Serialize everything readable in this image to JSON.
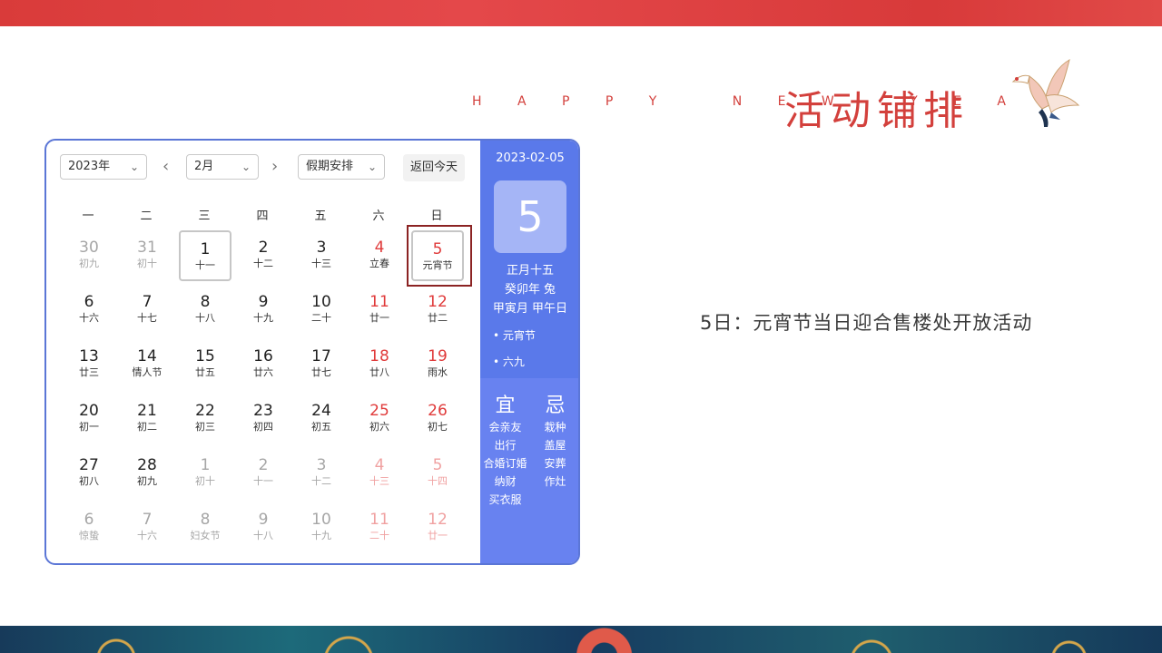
{
  "header": {
    "subtitle": "H A P P Y   N E W   Y E A R",
    "title": "活动铺排"
  },
  "calendar": {
    "year_select": "2023年",
    "month_select": "2月",
    "holiday_select": "假期安排",
    "today_button": "返回今天",
    "weekdays": [
      "一",
      "二",
      "三",
      "四",
      "五",
      "六",
      "日"
    ],
    "days": [
      {
        "num": "30",
        "lunar": "初九",
        "type": "other"
      },
      {
        "num": "31",
        "lunar": "初十",
        "type": "other"
      },
      {
        "num": "1",
        "lunar": "十一",
        "type": "today"
      },
      {
        "num": "2",
        "lunar": "十二",
        "type": "normal"
      },
      {
        "num": "3",
        "lunar": "十三",
        "type": "normal"
      },
      {
        "num": "4",
        "lunar": "立春",
        "type": "red"
      },
      {
        "num": "5",
        "lunar": "元宵节",
        "type": "red selected"
      },
      {
        "num": "6",
        "lunar": "十六",
        "type": "normal"
      },
      {
        "num": "7",
        "lunar": "十七",
        "type": "normal"
      },
      {
        "num": "8",
        "lunar": "十八",
        "type": "normal"
      },
      {
        "num": "9",
        "lunar": "十九",
        "type": "normal"
      },
      {
        "num": "10",
        "lunar": "二十",
        "type": "normal"
      },
      {
        "num": "11",
        "lunar": "廿一",
        "type": "red"
      },
      {
        "num": "12",
        "lunar": "廿二",
        "type": "red"
      },
      {
        "num": "13",
        "lunar": "廿三",
        "type": "normal"
      },
      {
        "num": "14",
        "lunar": "情人节",
        "type": "normal"
      },
      {
        "num": "15",
        "lunar": "廿五",
        "type": "normal"
      },
      {
        "num": "16",
        "lunar": "廿六",
        "type": "normal"
      },
      {
        "num": "17",
        "lunar": "廿七",
        "type": "normal"
      },
      {
        "num": "18",
        "lunar": "廿八",
        "type": "red"
      },
      {
        "num": "19",
        "lunar": "雨水",
        "type": "red"
      },
      {
        "num": "20",
        "lunar": "初一",
        "type": "normal"
      },
      {
        "num": "21",
        "lunar": "初二",
        "type": "normal"
      },
      {
        "num": "22",
        "lunar": "初三",
        "type": "normal"
      },
      {
        "num": "23",
        "lunar": "初四",
        "type": "normal"
      },
      {
        "num": "24",
        "lunar": "初五",
        "type": "normal"
      },
      {
        "num": "25",
        "lunar": "初六",
        "type": "red"
      },
      {
        "num": "26",
        "lunar": "初七",
        "type": "red"
      },
      {
        "num": "27",
        "lunar": "初八",
        "type": "normal"
      },
      {
        "num": "28",
        "lunar": "初九",
        "type": "normal"
      },
      {
        "num": "1",
        "lunar": "初十",
        "type": "other"
      },
      {
        "num": "2",
        "lunar": "十一",
        "type": "other"
      },
      {
        "num": "3",
        "lunar": "十二",
        "type": "other"
      },
      {
        "num": "4",
        "lunar": "十三",
        "type": "other red"
      },
      {
        "num": "5",
        "lunar": "十四",
        "type": "other red"
      },
      {
        "num": "6",
        "lunar": "惊蛰",
        "type": "other"
      },
      {
        "num": "7",
        "lunar": "十六",
        "type": "other"
      },
      {
        "num": "8",
        "lunar": "妇女节",
        "type": "other"
      },
      {
        "num": "9",
        "lunar": "十八",
        "type": "other"
      },
      {
        "num": "10",
        "lunar": "十九",
        "type": "other"
      },
      {
        "num": "11",
        "lunar": "二十",
        "type": "other red"
      },
      {
        "num": "12",
        "lunar": "廿一",
        "type": "other red"
      }
    ]
  },
  "detail": {
    "date": "2023-02-05",
    "big_day": "5",
    "lunar_date": "正月十五",
    "year_ganzhi": "癸卯年 兔",
    "month_day_ganzhi": "甲寅月 甲午日",
    "festivals": [
      "• 元宵节",
      "• 六九"
    ],
    "yi_title": "宜",
    "ji_title": "忌",
    "yi_items": [
      "会亲友",
      "出行",
      "合婚订婚",
      "纳财",
      "买衣服"
    ],
    "ji_items": [
      "栽种",
      "盖屋",
      "安葬",
      "作灶"
    ]
  },
  "note": "5日：元宵节当日迎合售楼处开放活动",
  "colors": {
    "brand_red": "#d3403c",
    "calendar_blue": "#5a79ea",
    "weekend_red": "#e03b3b"
  }
}
